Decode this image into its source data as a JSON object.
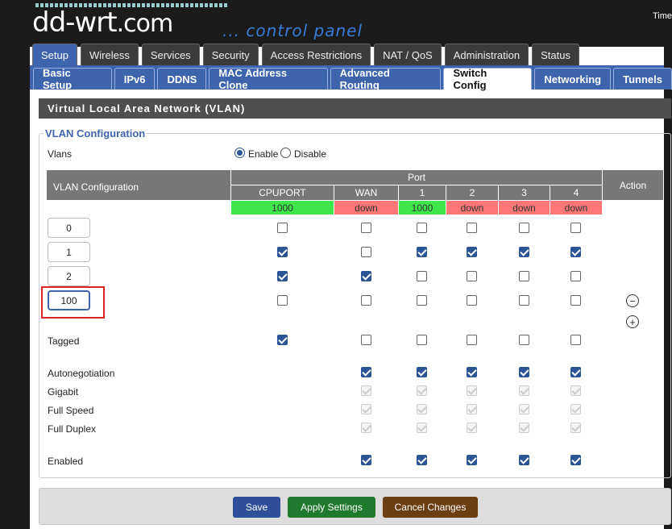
{
  "header": {
    "logo_text": "dd-wrt",
    "logo_suffix": ".com",
    "tagline": "... control panel",
    "time_label": "Time"
  },
  "main_tabs": [
    "Setup",
    "Wireless",
    "Services",
    "Security",
    "Access Restrictions",
    "NAT / QoS",
    "Administration",
    "Status"
  ],
  "sub_tabs": [
    "Basic Setup",
    "IPv6",
    "DDNS",
    "MAC Address Clone",
    "Advanced Routing",
    "Switch Config",
    "Networking",
    "Tunnels"
  ],
  "section_title": "Virtual Local Area Network (VLAN)",
  "legend": "VLAN Configuration",
  "vlans": {
    "label": "Vlans",
    "enable_label": "Enable",
    "disable_label": "Disable",
    "selected": "Enable"
  },
  "table": {
    "col_label": "VLAN Configuration",
    "port_label": "Port",
    "action_label": "Action",
    "ports": [
      "CPUPORT",
      "WAN",
      "1",
      "2",
      "3",
      "4"
    ],
    "port_status": [
      "1000",
      "down",
      "1000",
      "down",
      "down",
      "down"
    ],
    "vlan_ids": [
      "0",
      "1",
      "2",
      "100"
    ],
    "vlan_checks": [
      [
        false,
        false,
        false,
        false,
        false,
        false
      ],
      [
        true,
        false,
        true,
        true,
        true,
        true
      ],
      [
        true,
        true,
        false,
        false,
        false,
        false
      ],
      [
        false,
        false,
        false,
        false,
        false,
        false
      ]
    ],
    "tagged_label": "Tagged",
    "tagged": [
      true,
      false,
      false,
      false,
      false,
      false
    ],
    "autoneg_label": "Autonegotiation",
    "gigabit_label": "Gigabit",
    "fullspeed_label": "Full Speed",
    "fullduplex_label": "Full Duplex",
    "enabled_label": "Enabled",
    "remove_icon": "minus-circle-icon",
    "add_icon": "plus-circle-icon"
  },
  "buttons": {
    "save": "Save",
    "apply": "Apply Settings",
    "cancel": "Cancel Changes"
  },
  "colors": {
    "accent": "#3d64ad",
    "status_up": "#3ee64c",
    "status_down": "#ff7777"
  }
}
